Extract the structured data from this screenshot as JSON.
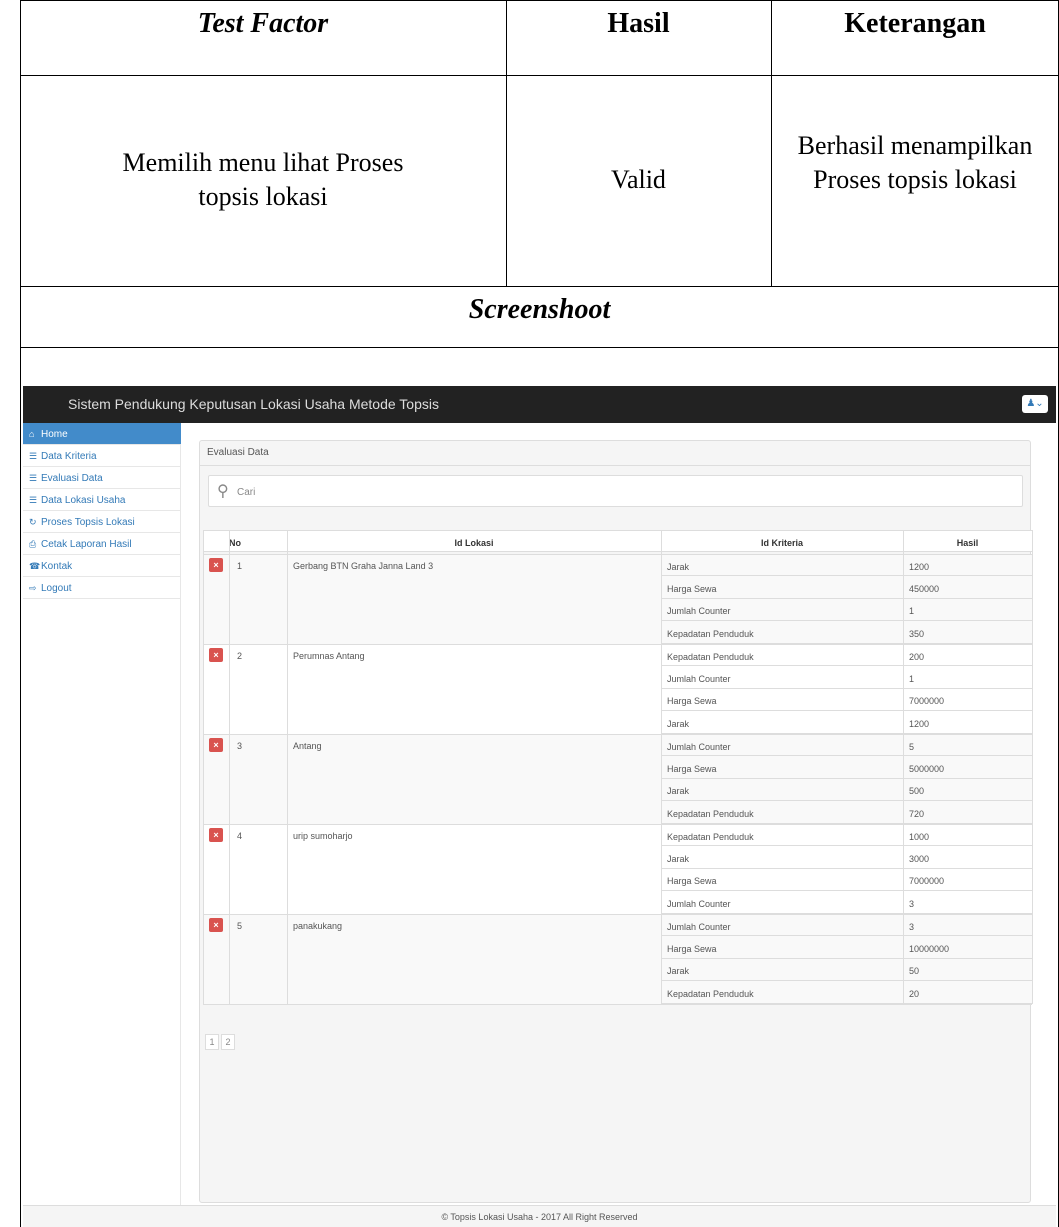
{
  "doc": {
    "headers": {
      "test_factor": "Test Factor",
      "hasil": "Hasil",
      "keterangan": "Keterangan"
    },
    "row": {
      "factor": "Memilih menu lihat Proses topsis lokasi",
      "hasil": "Valid",
      "keterangan": "Berhasil menampilkan Proses topsis lokasi"
    },
    "screenshot_label": "Screenshoot"
  },
  "app": {
    "brand": "Sistem Pendukung Keputusan Lokasi Usaha Metode Topsis",
    "sidebar": [
      {
        "label": "Home",
        "icon": "home-icon",
        "glyph": "⌂"
      },
      {
        "label": "Data Kriteria",
        "icon": "list-icon",
        "glyph": "☰"
      },
      {
        "label": "Evaluasi Data",
        "icon": "list-icon",
        "glyph": "☰"
      },
      {
        "label": "Data Lokasi Usaha",
        "icon": "list-icon",
        "glyph": "☰"
      },
      {
        "label": "Proses Topsis Lokasi",
        "icon": "refresh-icon",
        "glyph": "↻"
      },
      {
        "label": "Cetak Laporan Hasil",
        "icon": "print-icon",
        "glyph": "⎙"
      },
      {
        "label": "Kontak",
        "icon": "phone-icon",
        "glyph": "☎"
      },
      {
        "label": "Logout",
        "icon": "logout-icon",
        "glyph": "⇨"
      }
    ],
    "panel_title": "Evaluasi Data",
    "search_placeholder": "Cari",
    "table": {
      "headers": [
        "No",
        "Id Lokasi",
        "Id Kriteria",
        "Hasil"
      ],
      "groups": [
        {
          "no": "1",
          "lokasi": "Gerbang BTN Graha Janna Land 3",
          "rows": [
            [
              "Jarak",
              "1200"
            ],
            [
              "Harga Sewa",
              "450000"
            ],
            [
              "Jumlah Counter",
              "1"
            ],
            [
              "Kepadatan Penduduk",
              "350"
            ]
          ]
        },
        {
          "no": "2",
          "lokasi": "Perumnas Antang",
          "rows": [
            [
              "Kepadatan Penduduk",
              "200"
            ],
            [
              "Jumlah Counter",
              "1"
            ],
            [
              "Harga Sewa",
              "7000000"
            ],
            [
              "Jarak",
              "1200"
            ]
          ]
        },
        {
          "no": "3",
          "lokasi": "Antang",
          "rows": [
            [
              "Jumlah Counter",
              "5"
            ],
            [
              "Harga Sewa",
              "5000000"
            ],
            [
              "Jarak",
              "500"
            ],
            [
              "Kepadatan Penduduk",
              "720"
            ]
          ]
        },
        {
          "no": "4",
          "lokasi": "urip sumoharjo",
          "rows": [
            [
              "Kepadatan Penduduk",
              "1000"
            ],
            [
              "Jarak",
              "3000"
            ],
            [
              "Harga Sewa",
              "7000000"
            ],
            [
              "Jumlah Counter",
              "3"
            ]
          ]
        },
        {
          "no": "5",
          "lokasi": "panakukang",
          "rows": [
            [
              "Jumlah Counter",
              "3"
            ],
            [
              "Harga Sewa",
              "10000000"
            ],
            [
              "Jarak",
              "50"
            ],
            [
              "Kepadatan Penduduk",
              "20"
            ]
          ]
        }
      ],
      "delete_glyph": "×"
    },
    "pages": [
      "1",
      "2"
    ],
    "footer": "© Topsis Lokasi Usaha - 2017 All Right Reserved"
  }
}
